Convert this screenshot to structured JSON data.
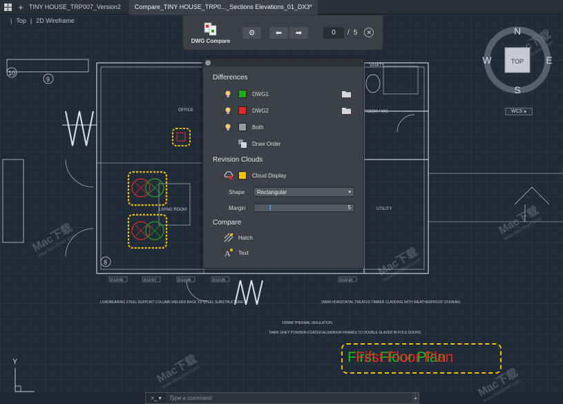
{
  "tabs": [
    {
      "label": "TINY HOUSE_TRP007_Version2",
      "active": false
    },
    {
      "label": "Compare_TINY HOUSE_TRP0..._Sections Elevations_01_DX3*",
      "active": true
    }
  ],
  "viewport": {
    "view": "Top",
    "style": "2D Wireframe"
  },
  "compare_toolbar": {
    "title": "DWG Compare",
    "page_current": "0",
    "page_separator": "/",
    "page_total": "5"
  },
  "differences_panel": {
    "differences_title": "Differences",
    "rows": [
      {
        "label": "DWG1",
        "color": "#21a821"
      },
      {
        "label": "DWG2",
        "color": "#e02b2b"
      },
      {
        "label": "Both",
        "color": "#9a9a9a"
      }
    ],
    "draw_order_label": "Draw Order",
    "revision_clouds_title": "Revision Clouds",
    "cloud_display_label": "Cloud Display",
    "cloud_color": "#f2c200",
    "shape_label": "Shape",
    "shape_value": "Rectangular",
    "margin_label": "Margin",
    "margin_value": "5",
    "compare_title": "Compare",
    "hatch_label": "Hatch",
    "text_label": "Text"
  },
  "viewcube": {
    "north": "N",
    "south": "S",
    "east": "E",
    "west": "W",
    "face": "TOP",
    "wcs": "WCS"
  },
  "command_line": {
    "prompt": ">_",
    "placeholder": "Type a command"
  },
  "ucs": {
    "y": "Y"
  },
  "drawing_labels": {
    "office": "OFFICE",
    "living_room": "LIVING ROOM",
    "room_wc": "ROOM / WC",
    "utility": "UTILITY",
    "vanity": "VANITY",
    "grid_9": "9",
    "grid_10": "10",
    "grid_8": "8",
    "lv_tags": [
      "D-LV-06",
      "D-LV-07",
      "D-LV-08",
      "D-LV-25",
      "D-LV-10"
    ],
    "note_left": "LOADBEARING STEEL SUPPORT COLUMN\nWELDED BACK TO STEEL SUBSTRUCTURE",
    "note_right": "25MM HORIZONTAL TREATED TIMBER CLADDING\nWITH WEATHERPROOF STAINING",
    "note_insulation": "100MM THERMAL INSULATION",
    "note_frames": "DARK GREY POWDER-COATED\nALUMINIUM FRAMES TO DOUBLE GLAZED BI-FOLD DOORS"
  },
  "plan_title": {
    "text_a": "First Floor Plan",
    "text_b": "Fifst Floor Plan",
    "color_a": "#15c21a",
    "color_b": "#ee2222"
  },
  "watermarks": [
    {
      "text": "Mac下载",
      "sub": "www.Macdown.com"
    },
    {
      "text": "Mac下载",
      "sub": "www.Macdown.com"
    },
    {
      "text": "Mac下载",
      "sub": "www.Macdown.com"
    },
    {
      "text": "Mac下载",
      "sub": "www.Macdown.com"
    },
    {
      "text": "Mac下载",
      "sub": "www.Macdown.com"
    },
    {
      "text": "Mac下载",
      "sub": "www.Macdown.com"
    },
    {
      "text": "Mac下载",
      "sub": "www.Macdown.com"
    }
  ]
}
